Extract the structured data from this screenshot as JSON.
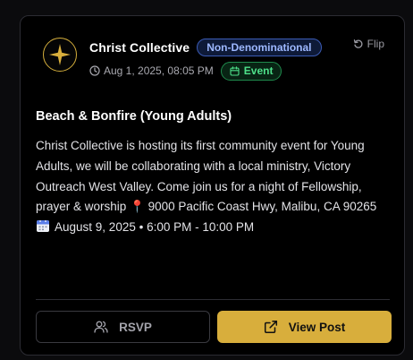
{
  "post": {
    "org_name": "Christ Collective",
    "denomination": "Non-Denominational",
    "flip_label": "Flip",
    "datetime": "Aug 1, 2025, 08:05 PM",
    "type_badge": "Event",
    "title": "Beach & Bonfire (Young Adults)",
    "body_text": "Christ Collective is hosting its first community event for Young Adults, we will be collaborating with a local ministry, Victory Outreach West Valley. Come join us for a night of Fellowship, prayer & worship ",
    "location_pin": "📍",
    "location": " 9000 Pacific Coast Hwy, Malibu, CA 90265",
    "event_time": "August 9, 2025 • 6:00 PM - 10:00 PM"
  },
  "actions": {
    "rsvp_label": "RSVP",
    "view_label": "View Post"
  },
  "colors": {
    "accent_gold": "#d8ae3c",
    "denomination_blue": "#9db8ff",
    "event_green": "#4ee08a"
  },
  "icons": {
    "avatar": "north-star-logo",
    "flip": "rotate-icon",
    "clock": "clock-icon",
    "event": "calendar-icon",
    "rsvp": "users-icon",
    "view": "external-link-icon"
  }
}
